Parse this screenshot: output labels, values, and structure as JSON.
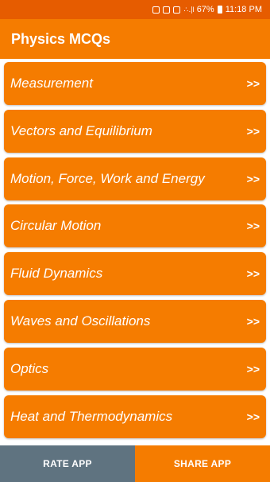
{
  "status_bar": {
    "battery": "67%",
    "time": "11:18 PM",
    "signal_text": "∴ .∣l"
  },
  "app_bar": {
    "title": "Physics MCQs"
  },
  "topics": [
    {
      "label": "Measurement",
      "arrow": ">>"
    },
    {
      "label": "Vectors and Equilibrium",
      "arrow": ">>"
    },
    {
      "label": "Motion, Force, Work and Energy",
      "arrow": ">>"
    },
    {
      "label": "Circular Motion",
      "arrow": ">>"
    },
    {
      "label": "Fluid Dynamics",
      "arrow": ">>"
    },
    {
      "label": "Waves and Oscillations",
      "arrow": ">>"
    },
    {
      "label": "Optics",
      "arrow": ">>"
    },
    {
      "label": "Heat and Thermodynamics",
      "arrow": ">>"
    }
  ],
  "bottom_bar": {
    "rate_label": "RATE APP",
    "share_label": "SHARE APP"
  },
  "colors": {
    "accent": "#f57c00",
    "status_bar": "#e65c00",
    "rate_button": "#5f7380"
  }
}
